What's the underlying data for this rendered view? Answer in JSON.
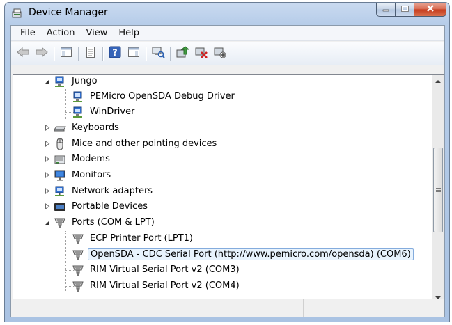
{
  "window": {
    "title": "Device Manager",
    "controls": {
      "minimize": "minimize",
      "maximize": "maximize",
      "close": "close"
    }
  },
  "menu": [
    "File",
    "Action",
    "View",
    "Help"
  ],
  "toolbar": {
    "buttons": [
      "back-icon",
      "forward-icon",
      "show-hide-console-tree-icon",
      "properties-icon",
      "help-icon",
      "action-pane-icon",
      "scan-hardware-icon",
      "update-driver-icon",
      "uninstall-icon",
      "disable-icon"
    ]
  },
  "tree": {
    "jungo": {
      "label": "Jungo",
      "children": [
        "PEMicro OpenSDA Debug Driver",
        "WinDriver"
      ]
    },
    "keyboards": "Keyboards",
    "mice": "Mice and other pointing devices",
    "modems": "Modems",
    "monitors": "Monitors",
    "network": "Network adapters",
    "portable": "Portable Devices",
    "ports": {
      "label": "Ports (COM & LPT)",
      "children": [
        "ECP Printer Port (LPT1)",
        "OpenSDA - CDC Serial Port (http://www.pemicro.com/opensda) (COM6)",
        "RIM Virtual Serial Port v2 (COM3)",
        "RIM Virtual Serial Port v2 (COM4)"
      ]
    },
    "selected": "OpenSDA - CDC Serial Port (http://www.pemicro.com/opensda) (COM6)"
  },
  "colors": {
    "selection_bg": "#e8f3fd",
    "selection_border": "#84acdd",
    "titlebar": "#b7cde9"
  }
}
